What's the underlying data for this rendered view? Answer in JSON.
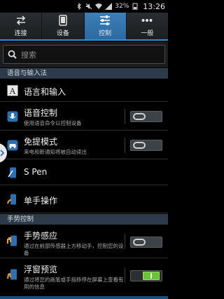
{
  "status_bar": {
    "battery": "32%",
    "time": "13:26"
  },
  "tabs": [
    {
      "label": "连接",
      "icon": "swap-arrows-icon"
    },
    {
      "label": "设备",
      "icon": "phone-icon"
    },
    {
      "label": "控制",
      "icon": "sliders-icon"
    },
    {
      "label": "一般",
      "icon": "more-dots-icon"
    }
  ],
  "search": {
    "placeholder": "搜索"
  },
  "sections": {
    "language_input": "语音与输入法",
    "motion_control": "手势控制"
  },
  "rows": {
    "language": {
      "title": "语言和输入",
      "icon": "font-a-icon"
    },
    "voice_control": {
      "title": "语音控制",
      "subtitle": "使用语音命令以控制设备",
      "toggle": "off"
    },
    "hands_free": {
      "title": "免提模式",
      "subtitle": "来电和新通知将被自动读出",
      "toggle": "off"
    },
    "s_pen": {
      "title": "S Pen"
    },
    "one_hand": {
      "title": "单手操作"
    },
    "gesture": {
      "title": "手势感应",
      "subtitle": "通过在前部传感器上方移动手，控制您的设备",
      "toggle": "off"
    },
    "air_view": {
      "title": "浮窗预览",
      "subtitle": "通过将您的画笔或手指移停在屏幕上查看有用的信息",
      "toggle": "on"
    }
  },
  "colors": {
    "accent": "#2f8fcf",
    "toggle_on": "#6ac23a",
    "section_bg": "#2c3a4a"
  }
}
